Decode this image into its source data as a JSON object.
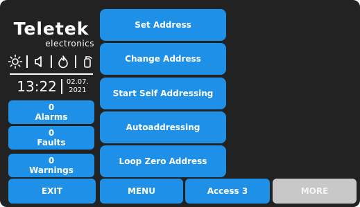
{
  "brand": {
    "name": "Teletek",
    "subtitle": "electronics"
  },
  "status_icons": [
    "sun-icon",
    "speaker-icon",
    "fire-icon",
    "extinguisher-icon"
  ],
  "clock": {
    "time": "13:22",
    "date_line1": "02.07.",
    "date_line2": "2021"
  },
  "counters": {
    "alarms": {
      "count": "0",
      "label": "Alarms"
    },
    "faults": {
      "count": "0",
      "label": "Faults"
    },
    "warnings": {
      "count": "0",
      "label": "Warnings"
    }
  },
  "menu": {
    "set_address": "Set Address",
    "change_address": "Change Address",
    "start_self_addressing": "Start Self Addressing",
    "autoaddressing": "Autoaddressing",
    "loop_zero_address": "Loop Zero Address"
  },
  "bottom": {
    "exit": "EXIT",
    "menu": "MENU",
    "access": "Access 3",
    "more": "MORE"
  },
  "colors": {
    "button_blue": "#1e90e8",
    "background": "#222222",
    "disabled": "#c8c8c8"
  }
}
